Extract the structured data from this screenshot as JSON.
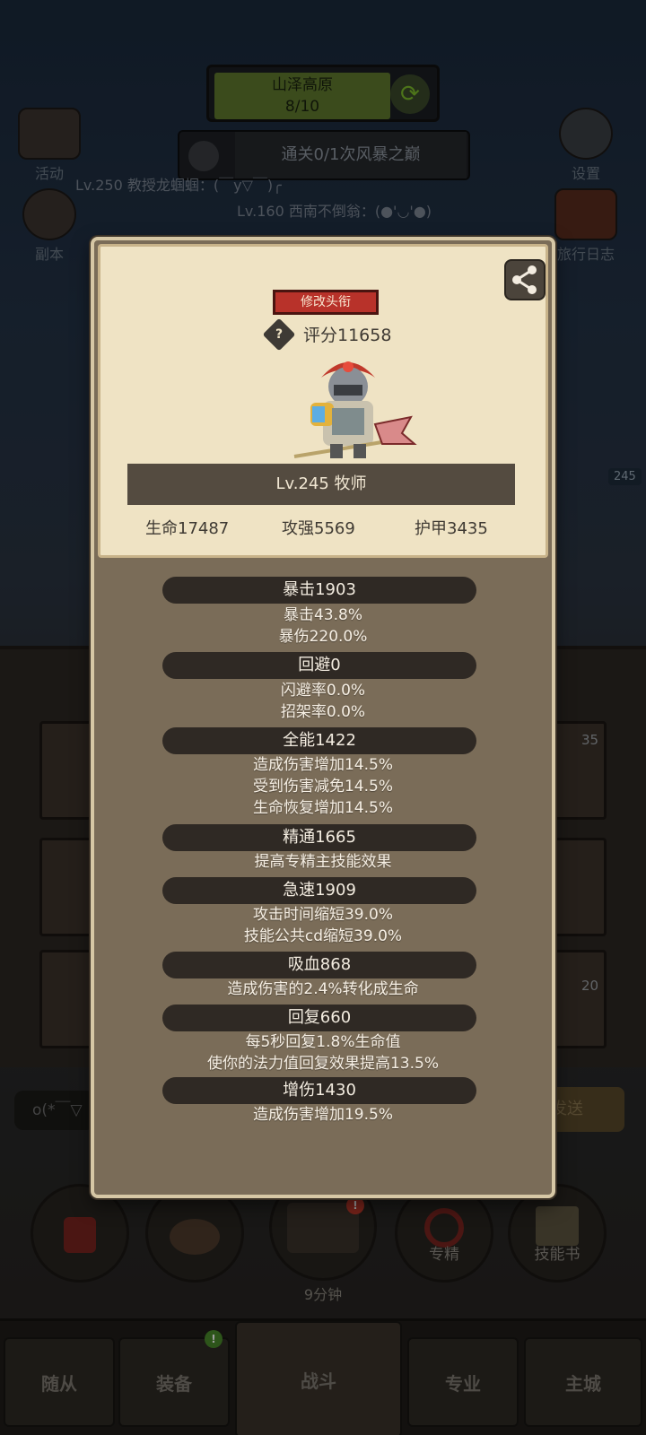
{
  "background": {
    "zone": {
      "name": "山泽高原",
      "progress": "8/10"
    },
    "quest": {
      "text": "通关0/1次风暴之巅"
    },
    "chat": [
      "Lv.250 教授龙蝈蝈：(￣y▽￣)╭",
      "Lv.160 西南不倒翁：(●'◡'●)"
    ],
    "left_buttons": {
      "activity": "活动",
      "dungeon": "副本"
    },
    "right_buttons": {
      "settings": "设置",
      "journal": "旅行日志"
    },
    "slot_numbers": [
      "35",
      "20"
    ],
    "level_badges": [
      "245"
    ],
    "chat_input_preview": "o(*￣▽",
    "send_label": "发送",
    "round_buttons": {
      "specialization": "专精",
      "skill_book": "技能书",
      "chest_timer": "9分钟"
    },
    "nav_tabs": [
      "随从",
      "装备",
      "战斗",
      "专业",
      "主城"
    ]
  },
  "dialog": {
    "edit_title_label": "修改头衔",
    "score_label": "评分11658",
    "help_glyph": "?",
    "class_label": "Lv.245 牧师",
    "base_stats": {
      "hp": "生命17487",
      "attack": "攻强5569",
      "armor": "护甲3435"
    },
    "sections": [
      {
        "title": "暴击1903",
        "lines": [
          "暴击43.8%",
          "暴伤220.0%"
        ]
      },
      {
        "title": "回避0",
        "lines": [
          "闪避率0.0%",
          "招架率0.0%"
        ]
      },
      {
        "title": "全能1422",
        "lines": [
          "造成伤害增加14.5%",
          "受到伤害减免14.5%",
          "生命恢复增加14.5%"
        ]
      },
      {
        "title": "精通1665",
        "lines": [
          "提高专精主技能效果"
        ]
      },
      {
        "title": "急速1909",
        "lines": [
          "攻击时间缩短39.0%",
          "技能公共cd缩短39.0%"
        ]
      },
      {
        "title": "吸血868",
        "lines": [
          "造成伤害的2.4%转化成生命"
        ]
      },
      {
        "title": "回复660",
        "lines": [
          "每5秒回复1.8%生命值",
          "使你的法力值回复效果提高13.5%"
        ]
      },
      {
        "title": "增伤1430",
        "lines": [
          "造成伤害增加19.5%"
        ]
      }
    ]
  },
  "colors": {
    "parchment": "#efe3c4",
    "dialog_body": "#7a6c58",
    "section_band": "#2f2924",
    "title_button": "#b8322a"
  }
}
